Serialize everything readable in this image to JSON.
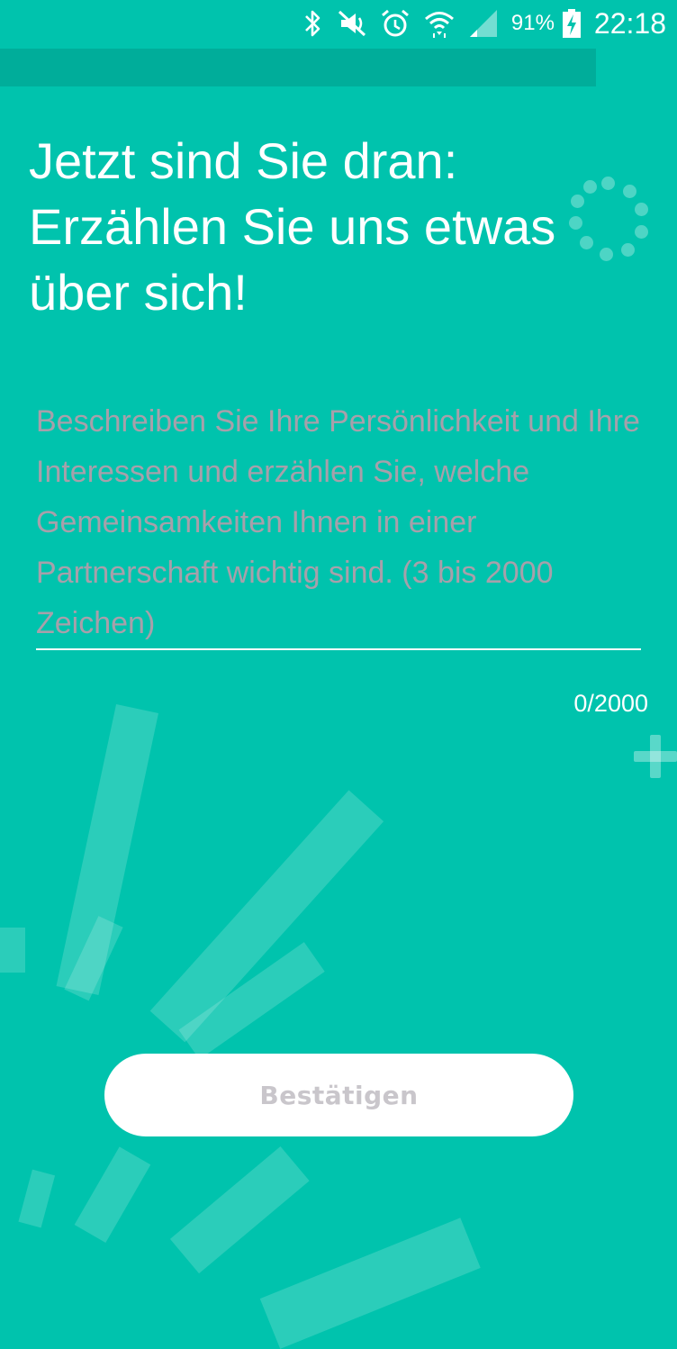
{
  "status_bar": {
    "icons": [
      "bluetooth-icon",
      "mute-icon",
      "alarm-icon",
      "wifi-icon",
      "signal-icon",
      "battery-charging-icon"
    ],
    "battery_percent": "91%",
    "time": "22:18"
  },
  "progress": {
    "fraction": 0.88
  },
  "title": "Jetzt sind Sie dran: Erzählen Sie uns etwas über sich!",
  "about_input": {
    "value": "",
    "placeholder": "Beschreiben Sie Ihre Persönlichkeit und Ihre Interessen und erzählen Sie, welche Gemeinsamkeiten Ihnen in einer Partnerschaft wichtig sind. (3 bis 2000 Zeichen)"
  },
  "char_counter": "0/2000",
  "confirm_button": {
    "label": "Bestätigen"
  },
  "colors": {
    "background": "#00c3ad",
    "progress_track": "#00ad9a",
    "placeholder": "#a7a0aa",
    "button_text_disabled": "#c9c6cb"
  }
}
